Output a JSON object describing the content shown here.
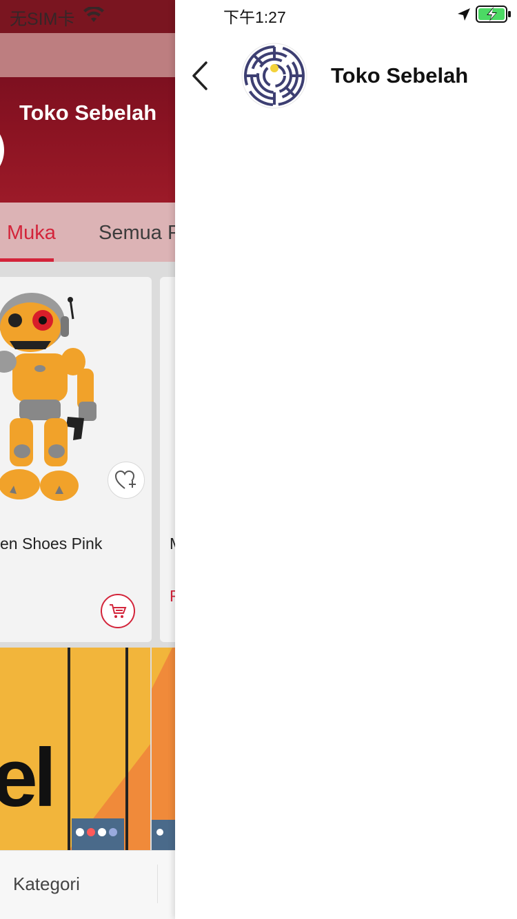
{
  "background_page": {
    "status_carrier": "无SIM卡",
    "header_title": "Toko Sebelah",
    "tabs": [
      {
        "label": "Muka",
        "active": true
      },
      {
        "label": "Semua P",
        "active": false
      }
    ],
    "products": [
      {
        "title": "en Shoes Pink"
      },
      {
        "title": "M",
        "price": "R"
      }
    ],
    "banner_text": "el",
    "bottom_tab": {
      "label": "Kategori"
    }
  },
  "status_bar": {
    "time": "下午1:27"
  },
  "nav": {
    "title": "Toko Sebelah"
  },
  "icons": {
    "back": "chevron-left-icon",
    "logo": "maze-logo",
    "location": "location-arrow-icon",
    "battery": "battery-charging-icon",
    "wifi": "wifi-icon",
    "wish": "heart-plus-icon",
    "cart": "cart-icon"
  },
  "colors": {
    "brand_red": "#d3243a",
    "header_red": "#8a1322",
    "battery_green": "#4cd964"
  }
}
